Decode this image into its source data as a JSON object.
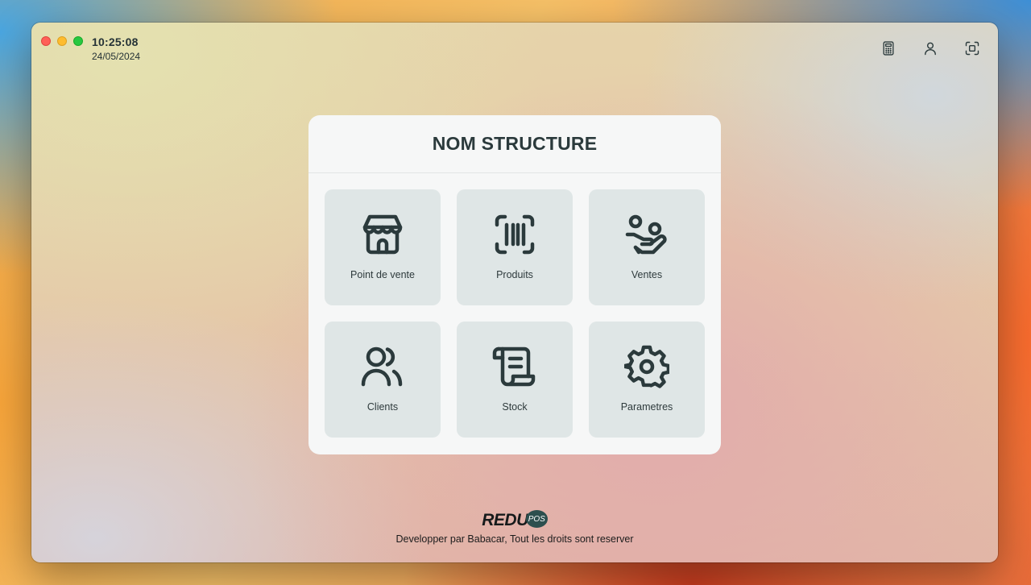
{
  "window": {
    "controls": [
      "close",
      "minimize",
      "maximize"
    ],
    "time": "10:25:08",
    "date": "24/05/2024",
    "actions": [
      {
        "icon": "calculator-icon"
      },
      {
        "icon": "user-icon"
      },
      {
        "icon": "fullscreen-icon"
      }
    ]
  },
  "card": {
    "title": "NOM STRUCTURE",
    "tiles": [
      {
        "label": "Point de vente",
        "icon": "store-icon"
      },
      {
        "label": "Produits",
        "icon": "barcode-scan-icon"
      },
      {
        "label": "Ventes",
        "icon": "hand-coin-icon"
      },
      {
        "label": "Clients",
        "icon": "users-icon"
      },
      {
        "label": "Stock",
        "icon": "scroll-icon"
      },
      {
        "label": "Parametres",
        "icon": "gear-icon"
      }
    ]
  },
  "footer": {
    "logo_text": "REDU",
    "logo_badge": "POS",
    "credit": "Developper par Babacar, Tout les droits sont reserver"
  },
  "colors": {
    "icon": "#2b3a3c",
    "tile": "#dfe6e6",
    "card": "#f6f7f7"
  }
}
